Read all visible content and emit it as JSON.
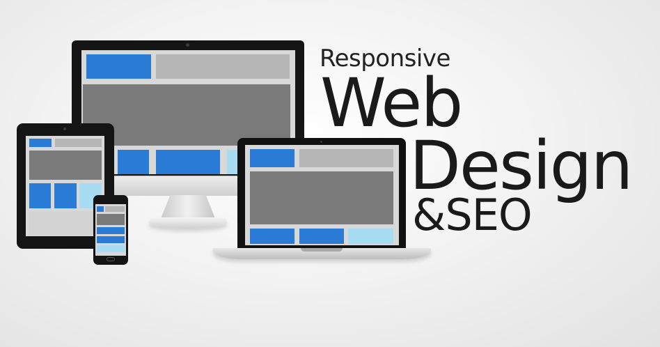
{
  "headline": {
    "line1": "Responsive",
    "line2": "Web",
    "line3": "Design",
    "line4": "&SEO"
  },
  "colors": {
    "primary_blue": "#2a7bd6",
    "light_blue": "#a8dcf3",
    "placeholder_grey": "#b5b5b5",
    "content_grey": "#7a7a7a",
    "device_black": "#151515",
    "text": "#1a1a1a"
  },
  "devices": [
    "desktop-monitor",
    "tablet",
    "smartphone",
    "laptop"
  ]
}
